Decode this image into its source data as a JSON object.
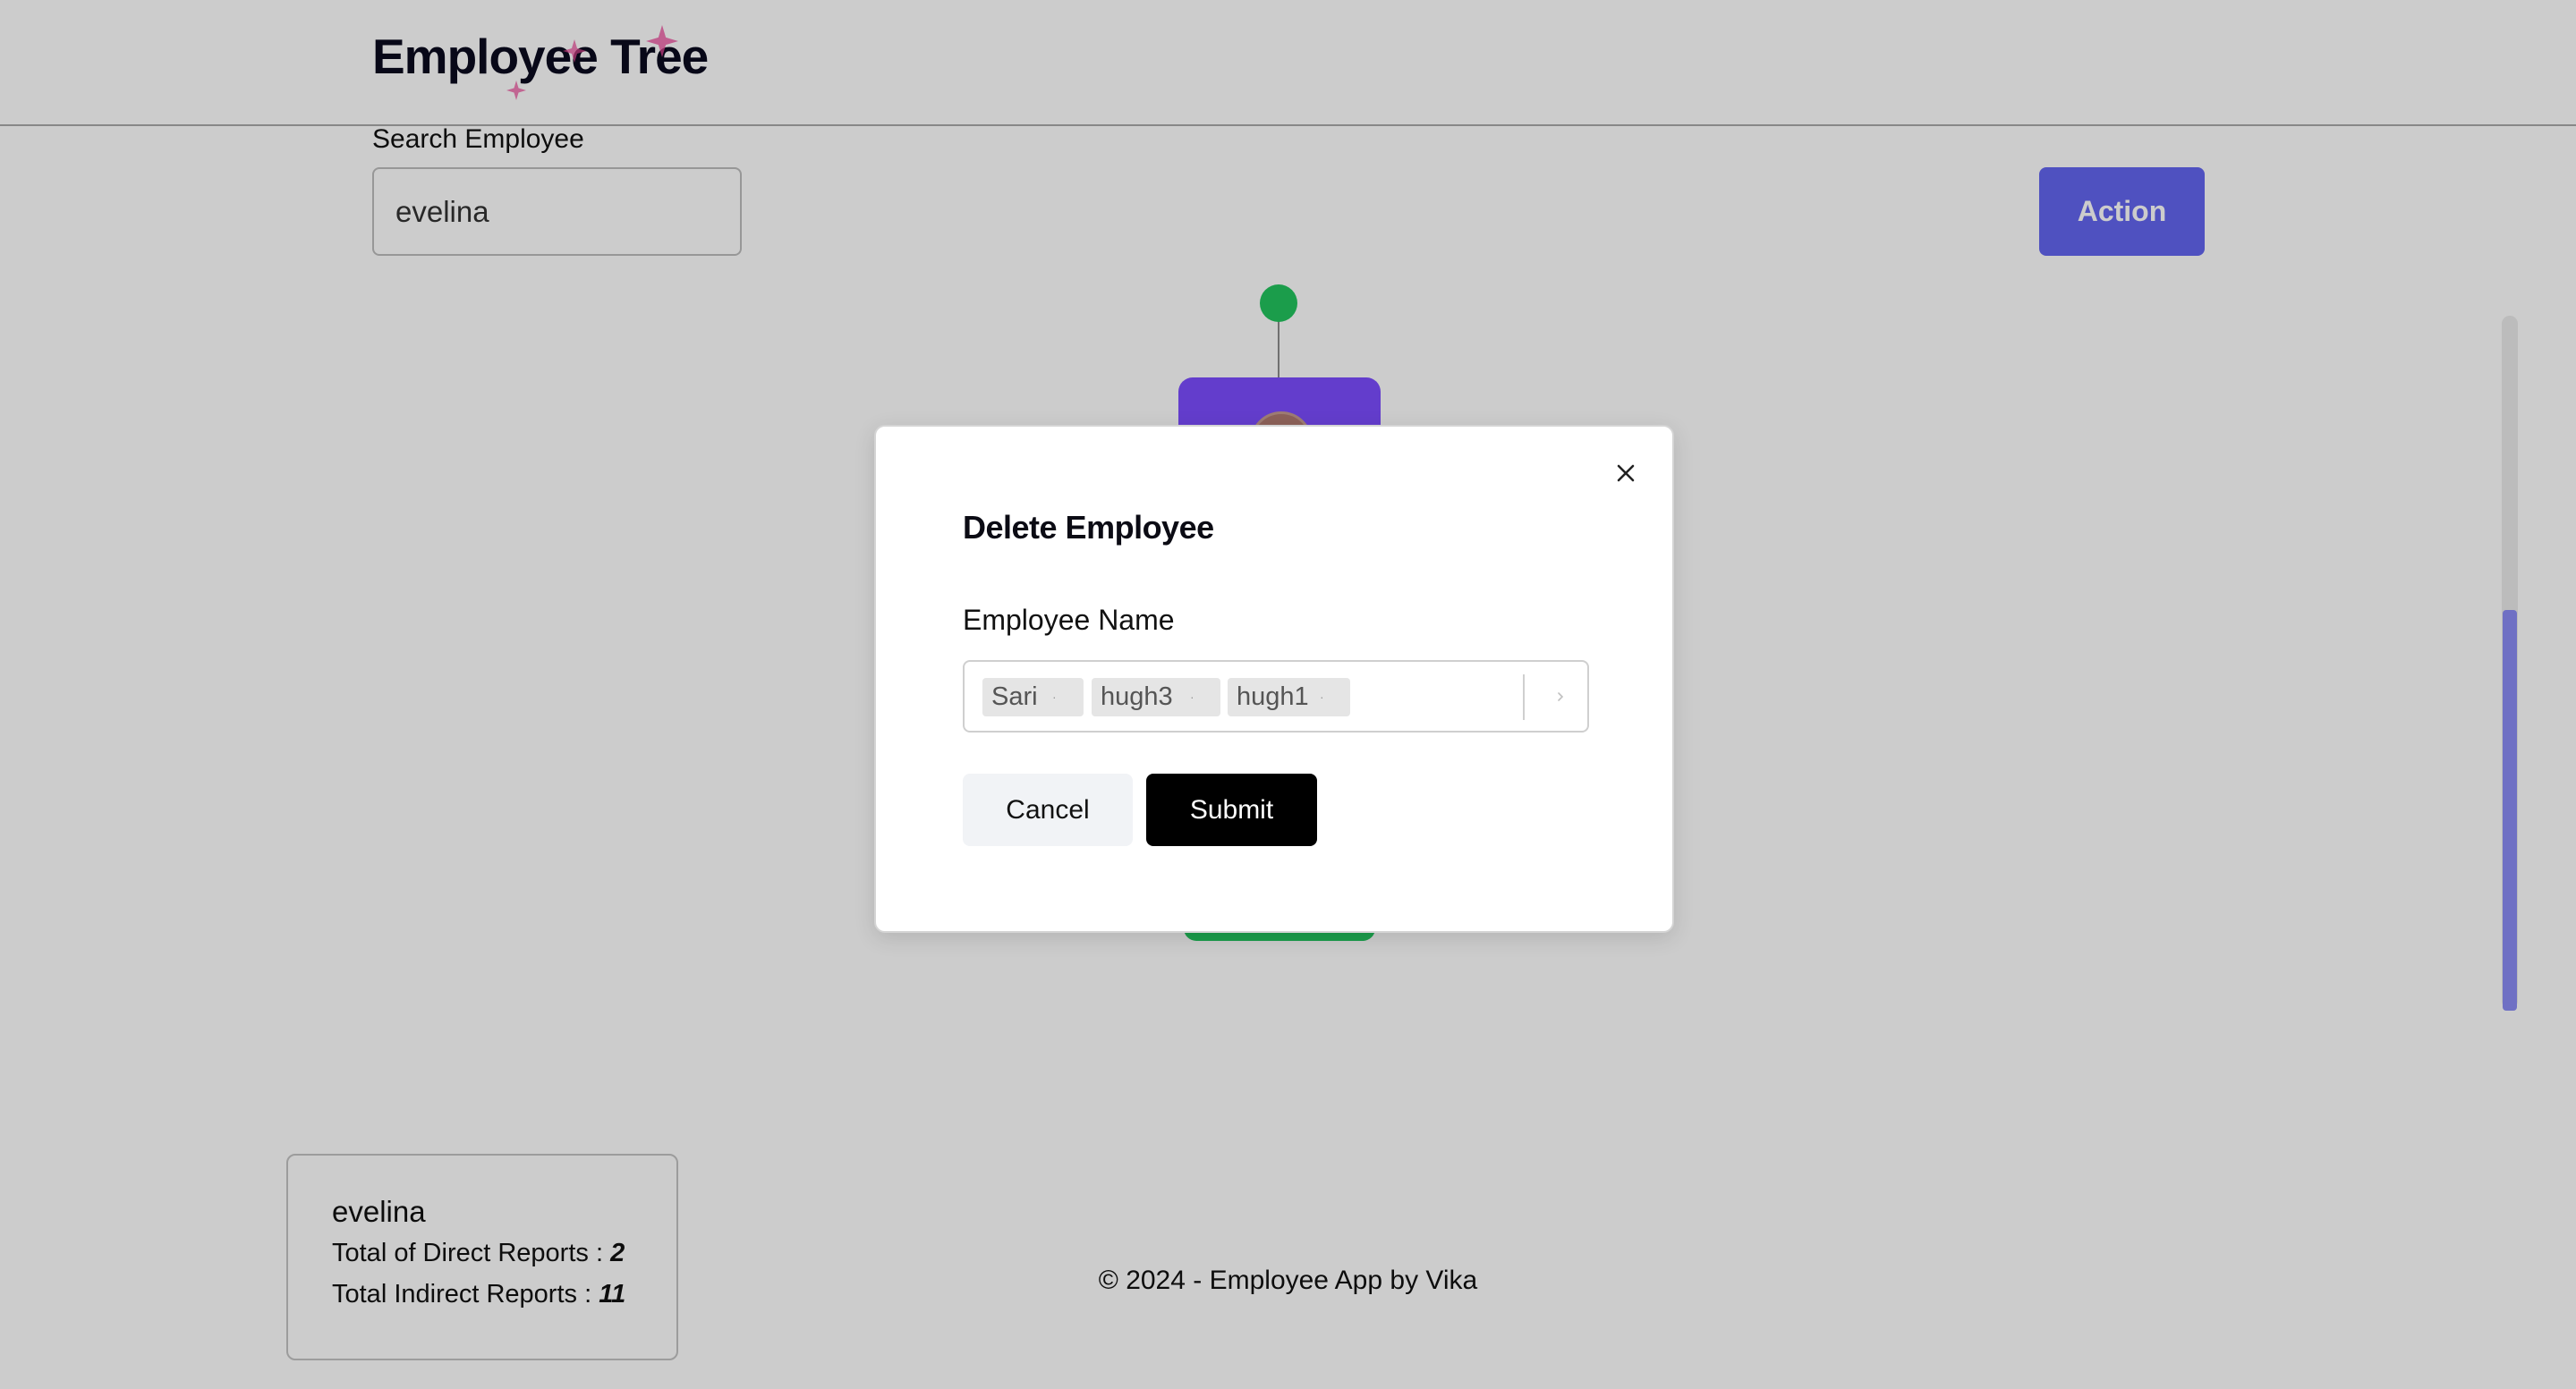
{
  "header": {
    "logo_text": "Employee Tree"
  },
  "search": {
    "label": "Search Employee",
    "value": "evelina"
  },
  "toolbar": {
    "action_label": "Action"
  },
  "info_card": {
    "name": "evelina",
    "direct_label": "Total of Direct Reports : ",
    "direct_value": "2",
    "indirect_label": "Total Indirect Reports : ",
    "indirect_value": "11"
  },
  "footer": {
    "text": "© 2024 - Employee App by Vika"
  },
  "modal": {
    "title": "Delete Employee",
    "field_label": "Employee Name",
    "selected": [
      "Sari",
      "hugh3",
      "hugh1"
    ],
    "cancel_label": "Cancel",
    "submit_label": "Submit"
  },
  "colors": {
    "action_button": "#6366f1",
    "tree_node": "#7c4dff",
    "tree_toggle": "#22c55e",
    "logo_sparkle": "#ec4899",
    "submit_button": "#000000"
  },
  "icons": {
    "close": "close-icon",
    "chevron": "chevron-right-icon",
    "chip_remove": "remove-icon"
  }
}
